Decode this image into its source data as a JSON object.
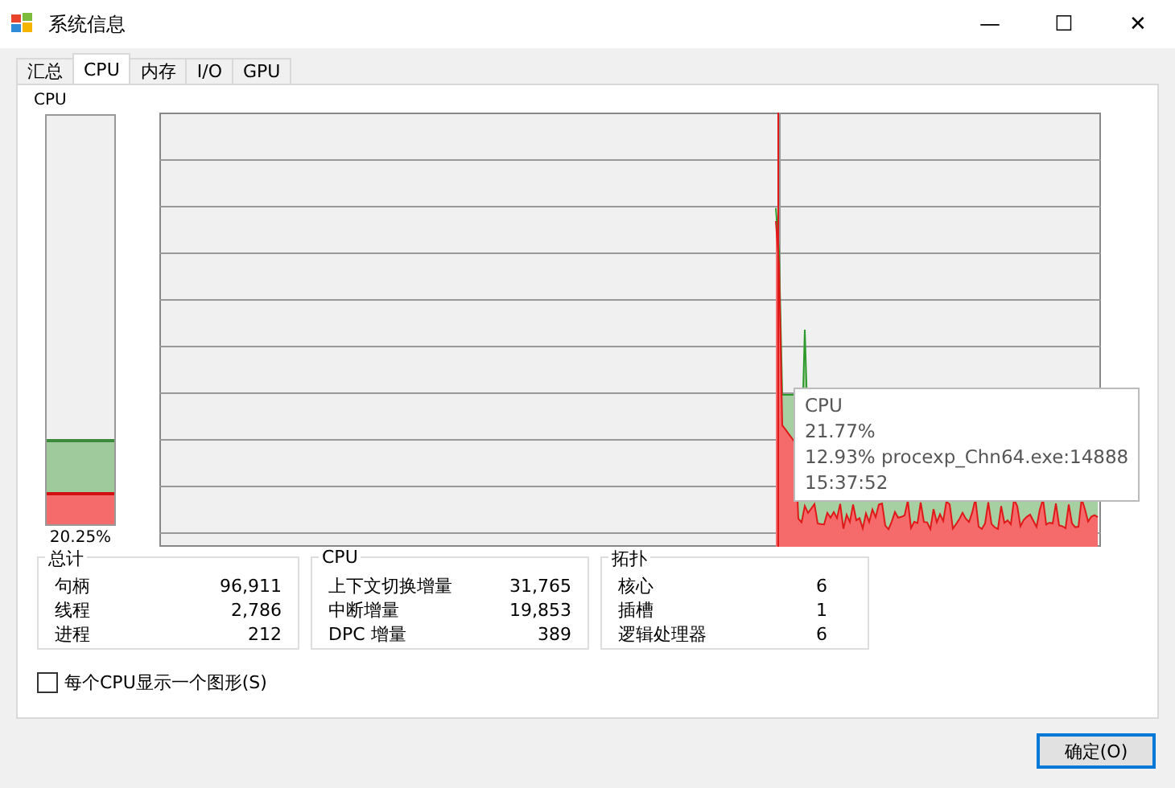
{
  "window": {
    "title": "系统信息",
    "controls": [
      "—",
      "☐",
      "✕"
    ]
  },
  "tabs": [
    {
      "label": "汇总",
      "selected": false
    },
    {
      "label": "CPU",
      "selected": true
    },
    {
      "label": "内存",
      "selected": false
    },
    {
      "label": "I/O",
      "selected": false
    },
    {
      "label": "GPU",
      "selected": false
    }
  ],
  "meter": {
    "label": "CPU",
    "reading": "20.25%",
    "segments": [
      {
        "level": 0.2025,
        "color": "#9fcb9c"
      },
      {
        "level": 0.07,
        "color": "#f56b6b"
      }
    ]
  },
  "tooltip": {
    "lines": [
      "CPU",
      "21.77%",
      "12.93% procexp_Chn64.exe:14888",
      "15:37:52"
    ]
  },
  "groups": [
    {
      "title": "总计",
      "rows": [
        {
          "label": "句柄",
          "value": "96,911"
        },
        {
          "label": "线程",
          "value": "2,786"
        },
        {
          "label": "进程",
          "value": "212"
        }
      ]
    },
    {
      "title": "CPU",
      "rows": [
        {
          "label": "上下文切换增量",
          "value": "31,765"
        },
        {
          "label": "中断增量",
          "value": "19,853"
        },
        {
          "label": "DPC 增量",
          "value": "389"
        }
      ]
    },
    {
      "title": "拓扑",
      "rows": [
        {
          "label": "核心",
          "value": "6"
        },
        {
          "label": "插槽",
          "value": "1"
        },
        {
          "label": "逻辑处理器",
          "value": "6"
        }
      ]
    }
  ],
  "checkbox": {
    "label": "每个CPU显示一个图形(S)",
    "checked": false
  },
  "buttons": [
    "确定(O)"
  ]
}
